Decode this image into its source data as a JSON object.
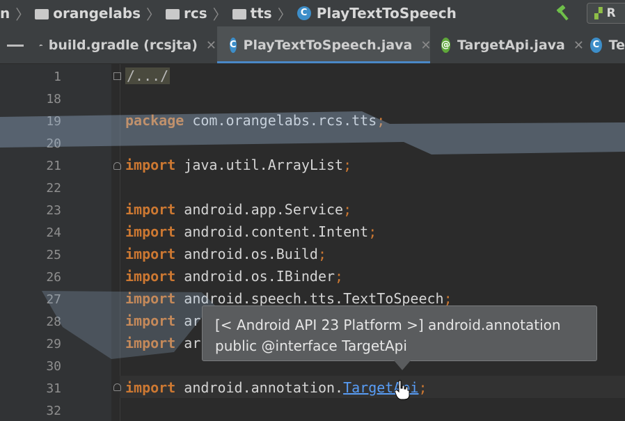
{
  "breadcrumb": {
    "items": [
      {
        "label": "n",
        "icon": "none"
      },
      {
        "label": "orangelabs",
        "icon": "folder-icon"
      },
      {
        "label": "rcs",
        "icon": "folder-icon"
      },
      {
        "label": "tts",
        "icon": "folder-icon"
      },
      {
        "label": "PlayTextToSpeech",
        "icon": "class-icon"
      }
    ]
  },
  "toolbar": {
    "run_label": "R",
    "build_icon": "hammer-icon"
  },
  "tabs": [
    {
      "label": "build.gradle (rcsjta)",
      "icon": "gradle-icon",
      "active": false
    },
    {
      "label": "PlayTextToSpeech.java",
      "icon": "class-icon",
      "active": true
    },
    {
      "label": "TargetApi.java",
      "icon": "annotation-icon",
      "active": false
    },
    {
      "label": "Te",
      "icon": "class-icon",
      "active": false
    }
  ],
  "editor": {
    "lines": [
      {
        "num": "1",
        "kind": "fold",
        "text": "/.../"
      },
      {
        "num": "18",
        "kind": "blank",
        "text": ""
      },
      {
        "num": "19",
        "kind": "package",
        "keyword": "package",
        "text": " com.orangelabs.rcs.tts",
        "end": ";"
      },
      {
        "num": "20",
        "kind": "blank",
        "text": ""
      },
      {
        "num": "21",
        "kind": "import",
        "keyword": "import",
        "text": " java.util.ArrayList",
        "end": ";"
      },
      {
        "num": "22",
        "kind": "blank",
        "text": ""
      },
      {
        "num": "23",
        "kind": "import",
        "keyword": "import",
        "text": " android.app.Service",
        "end": ";"
      },
      {
        "num": "24",
        "kind": "import",
        "keyword": "import",
        "text": " android.content.Intent",
        "end": ";"
      },
      {
        "num": "25",
        "kind": "import",
        "keyword": "import",
        "text": " android.os.Build",
        "end": ";"
      },
      {
        "num": "26",
        "kind": "import",
        "keyword": "import",
        "text": " android.os.IBinder",
        "end": ";"
      },
      {
        "num": "27",
        "kind": "import",
        "keyword": "import",
        "text": " android.speech.tts.TextToSpeech",
        "end": ";"
      },
      {
        "num": "28",
        "kind": "import",
        "keyword": "import",
        "text": " ar",
        "end": ""
      },
      {
        "num": "29",
        "kind": "import",
        "keyword": "import",
        "text": " ar",
        "end": ""
      },
      {
        "num": "30",
        "kind": "blank",
        "text": ""
      },
      {
        "num": "31",
        "kind": "import-link",
        "keyword": "import",
        "text": " android.annotation.",
        "link": "TargetApi",
        "end": ";"
      },
      {
        "num": "32",
        "kind": "blank",
        "text": ""
      }
    ]
  },
  "tooltip": {
    "line1": "[< Android API 23 Platform >] android.annotation",
    "line2": "public @interface TargetApi"
  },
  "colors": {
    "keyword": "#cc7832",
    "link": "#589df6",
    "accent": "#4a88c7",
    "background": "#2b2b2b"
  }
}
